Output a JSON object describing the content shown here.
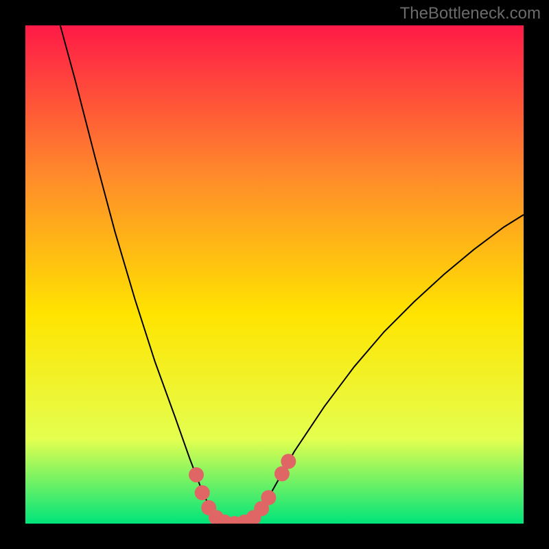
{
  "watermark": "TheBottleneck.com",
  "chart_data": {
    "type": "line",
    "title": "",
    "xlabel": "",
    "ylabel": "",
    "xlim": [
      0,
      100
    ],
    "ylim": [
      0,
      100
    ],
    "background_gradient": {
      "top": "#ff1a47",
      "upper_mid": "#ff8a2b",
      "mid": "#ffe400",
      "lower_mid": "#e4ff4f",
      "bottom": "#00e47a"
    },
    "series": [
      {
        "name": "bottleneck-curve",
        "color": "#000000",
        "stroke_width": 2,
        "points": [
          {
            "x": 7.0,
            "y": 100.0
          },
          {
            "x": 10.0,
            "y": 89.0
          },
          {
            "x": 14.0,
            "y": 73.5
          },
          {
            "x": 18.0,
            "y": 58.5
          },
          {
            "x": 22.0,
            "y": 45.0
          },
          {
            "x": 26.0,
            "y": 32.5
          },
          {
            "x": 30.0,
            "y": 21.5
          },
          {
            "x": 33.0,
            "y": 13.0
          },
          {
            "x": 35.5,
            "y": 6.5
          },
          {
            "x": 37.5,
            "y": 2.2
          },
          {
            "x": 39.0,
            "y": 0.6
          },
          {
            "x": 42.0,
            "y": 0.0
          },
          {
            "x": 45.0,
            "y": 0.6
          },
          {
            "x": 47.0,
            "y": 2.2
          },
          {
            "x": 49.5,
            "y": 6.5
          },
          {
            "x": 54.0,
            "y": 14.5
          },
          {
            "x": 60.0,
            "y": 23.5
          },
          {
            "x": 66.0,
            "y": 31.5
          },
          {
            "x": 72.0,
            "y": 38.5
          },
          {
            "x": 78.0,
            "y": 44.5
          },
          {
            "x": 84.0,
            "y": 50.0
          },
          {
            "x": 90.0,
            "y": 55.0
          },
          {
            "x": 96.0,
            "y": 59.5
          },
          {
            "x": 100.0,
            "y": 62.0
          }
        ]
      },
      {
        "name": "highlight-markers",
        "color": "#e06666",
        "marker_size": 11,
        "points": [
          {
            "x": 34.3,
            "y": 9.8
          },
          {
            "x": 35.5,
            "y": 6.2
          },
          {
            "x": 36.8,
            "y": 3.2
          },
          {
            "x": 38.3,
            "y": 1.2
          },
          {
            "x": 40.0,
            "y": 0.3
          },
          {
            "x": 42.0,
            "y": 0.0
          },
          {
            "x": 44.0,
            "y": 0.3
          },
          {
            "x": 45.8,
            "y": 1.2
          },
          {
            "x": 47.4,
            "y": 3.0
          },
          {
            "x": 48.8,
            "y": 5.2
          },
          {
            "x": 51.5,
            "y": 10.0
          },
          {
            "x": 52.8,
            "y": 12.5
          }
        ]
      }
    ]
  }
}
